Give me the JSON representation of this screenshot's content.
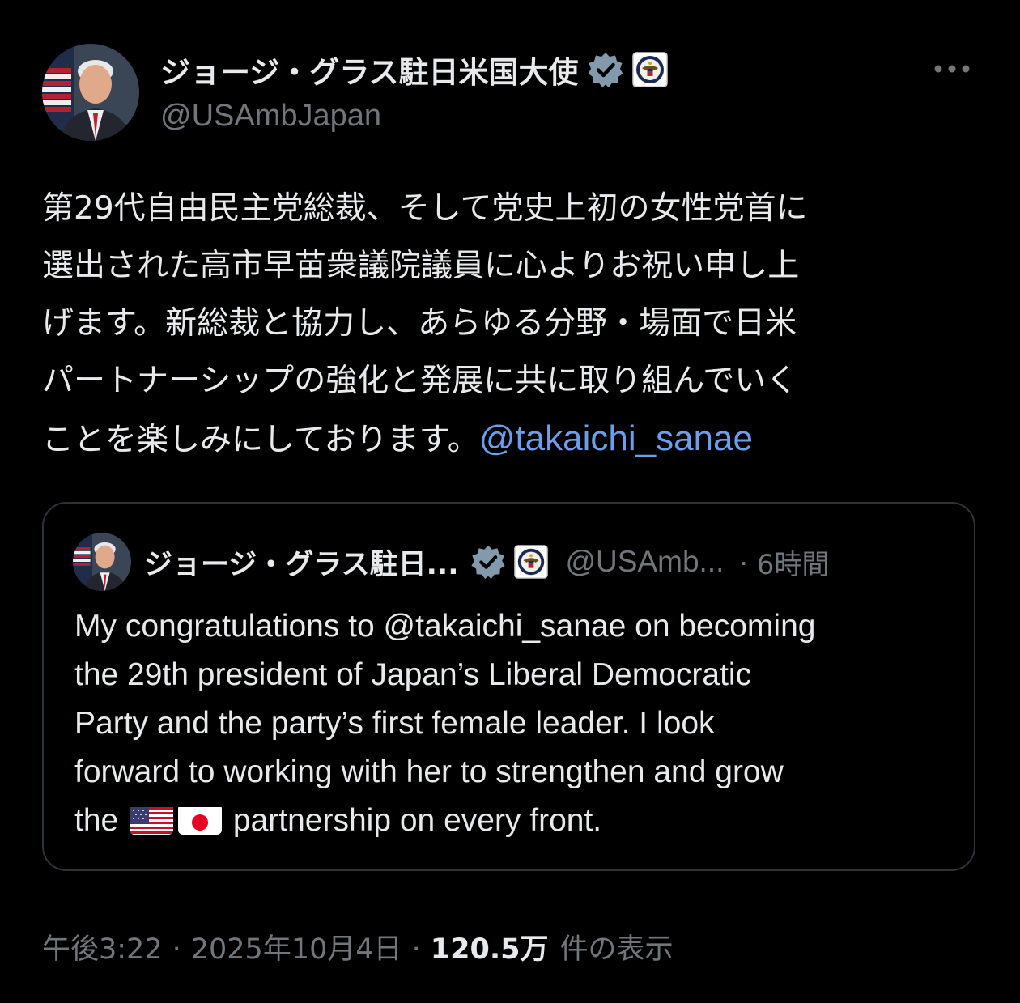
{
  "author": {
    "display_name": "ジョージ・グラス駐日米国大使",
    "handle": "@USAmbJapan",
    "avatar_icon": "ambassador-portrait-avatar",
    "verified_color": "#829aab"
  },
  "tweet": {
    "lines": [
      "第29代自由民主党総裁、そして党史上初の女性党首に",
      "選出された高市早苗衆議院議員に心よりお祝い申し上",
      "げます。新総裁と協力し、あらゆる分野・場面で日米",
      "パートナーシップの強化と発展に共に取り組んでいく"
    ],
    "last_line_text": "ことを楽しみにしております。",
    "mention": "@takaichi_sanae",
    "mention_color": "#6d9eeb"
  },
  "quote": {
    "display_name": "ジョージ・グラス駐日...",
    "handle": "@USAmb...",
    "separator": "·",
    "time": "6時間",
    "line1_prefix": "My congratulations to ",
    "line1_mention": "@takaichi_sanae",
    "line1_suffix": " on becoming",
    "line2": "the 29th president of Japan’s Liberal Democratic",
    "line3": "Party and the party’s first female leader. I look",
    "line4": "forward to working with her to strengthen and grow",
    "line5_prefix": "the",
    "line5_suffix": " partnership on every front.",
    "flags": [
      "us-flag-emoji",
      "japan-flag-emoji"
    ]
  },
  "footer": {
    "time": "午後3:22",
    "separator": "·",
    "date": "2025年10月4日",
    "views": "120.5万",
    "views_label": "件の表示"
  }
}
